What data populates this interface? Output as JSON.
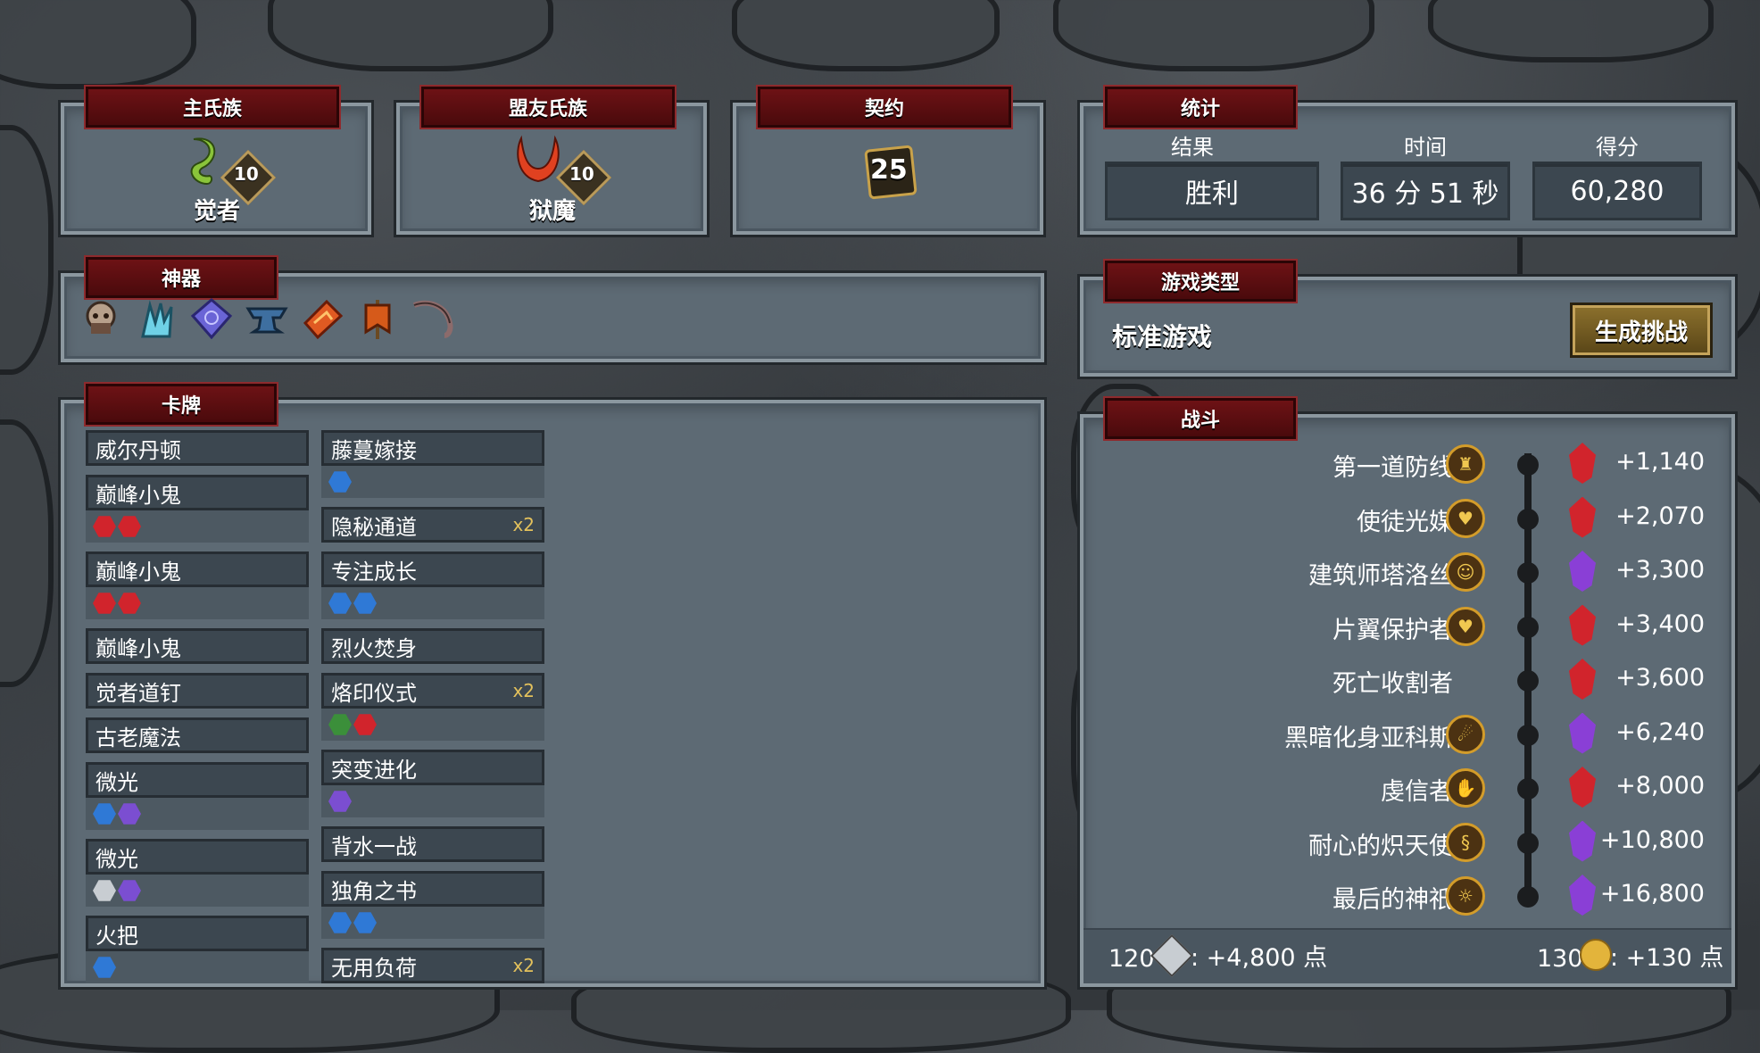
{
  "main_clan": {
    "title": "主氏族",
    "level": "10",
    "name": "觉者",
    "color": "#8ac43a"
  },
  "allied_clan": {
    "title": "盟友氏族",
    "level": "10",
    "name": "狱魔",
    "color": "#e04120"
  },
  "covenant": {
    "title": "契约",
    "level": "25"
  },
  "stats": {
    "title": "统计",
    "headers": [
      "结果",
      "时间",
      "得分"
    ],
    "values": [
      "胜利",
      "36 分 51 秒",
      "60,280"
    ]
  },
  "artifacts": {
    "title": "神器",
    "icons": [
      "skull-helm-icon",
      "frost-claw-icon",
      "crystal-rune-icon",
      "anvil-icon",
      "fire-shard-icon",
      "banner-icon",
      "bone-whip-icon"
    ]
  },
  "game_type": {
    "title": "游戏类型",
    "value": "标准游戏",
    "button": "生成挑战"
  },
  "deck": {
    "title": "卡牌",
    "left": [
      {
        "name": "威尔丹顿",
        "count": "",
        "upgrades": []
      },
      {
        "name": "巅峰小鬼",
        "count": "",
        "upgrades": [
          "#d1242c",
          "#d1242c"
        ]
      },
      {
        "name": "巅峰小鬼",
        "count": "",
        "upgrades": [
          "#d1242c",
          "#d1242c"
        ]
      },
      {
        "name": "巅峰小鬼",
        "count": "",
        "upgrades": []
      },
      {
        "name": "觉者道钉",
        "count": "",
        "upgrades": []
      },
      {
        "name": "古老魔法",
        "count": "",
        "upgrades": []
      },
      {
        "name": "微光",
        "count": "",
        "upgrades": [
          "#2f79d6",
          "#7b4ed1"
        ]
      },
      {
        "name": "微光",
        "count": "",
        "upgrades": [
          "#c8cdd2",
          "#7b4ed1"
        ]
      },
      {
        "name": "火把",
        "count": "",
        "upgrades": [
          "#2f79d6"
        ]
      }
    ],
    "right": [
      {
        "name": "藤蔓嫁接",
        "count": "",
        "upgrades": [
          "#2f79d6"
        ]
      },
      {
        "name": "隐秘通道",
        "count": "x2",
        "upgrades": []
      },
      {
        "name": "专注成长",
        "count": "",
        "upgrades": [
          "#2f79d6",
          "#2f79d6"
        ]
      },
      {
        "name": "烈火焚身",
        "count": "",
        "upgrades": []
      },
      {
        "name": "烙印仪式",
        "count": "x2",
        "upgrades": [
          "#3b8f3a",
          "#d1242c"
        ]
      },
      {
        "name": "突变进化",
        "count": "",
        "upgrades": [
          "#7b4ed1"
        ]
      },
      {
        "name": "背水一战",
        "count": "",
        "upgrades": []
      },
      {
        "name": "独角之书",
        "count": "",
        "upgrades": [
          "#2f79d6",
          "#2f79d6"
        ]
      },
      {
        "name": "无用负荷",
        "count": "x2",
        "upgrades": []
      }
    ]
  },
  "battles": {
    "title": "战斗",
    "rows": [
      {
        "name": "第一道防线",
        "icon": "castle-icon",
        "gem": "#d1242c",
        "score": "+1,140"
      },
      {
        "name": "使徒光媒",
        "icon": "heart-icon",
        "gem": "#d1242c",
        "score": "+2,070"
      },
      {
        "name": "建筑师塔洛丝",
        "icon": "face-icon",
        "gem": "#8a3fd6",
        "score": "+3,300"
      },
      {
        "name": "片翼保护者",
        "icon": "heart-icon",
        "gem": "#d1242c",
        "score": "+3,400"
      },
      {
        "name": "死亡收割者",
        "icon": "none",
        "gem": "#d1242c",
        "score": "+3,600"
      },
      {
        "name": "黑暗化身亚科斯",
        "icon": "flame-icon",
        "gem": "#8a3fd6",
        "score": "+6,240"
      },
      {
        "name": "虔信者",
        "icon": "hand-icon",
        "gem": "#d1242c",
        "score": "+8,000"
      },
      {
        "name": "耐心的炽天使",
        "icon": "swirl-icon",
        "gem": "#8a3fd6",
        "score": "+10,800"
      },
      {
        "name": "最后的神祇",
        "icon": "sun-icon",
        "gem": "#8a3fd6",
        "score": "+16,800"
      }
    ],
    "footer_left": {
      "count": "120",
      "text": ": +4,800 点"
    },
    "footer_right": {
      "count": "130",
      "text": ": +130 点"
    }
  }
}
